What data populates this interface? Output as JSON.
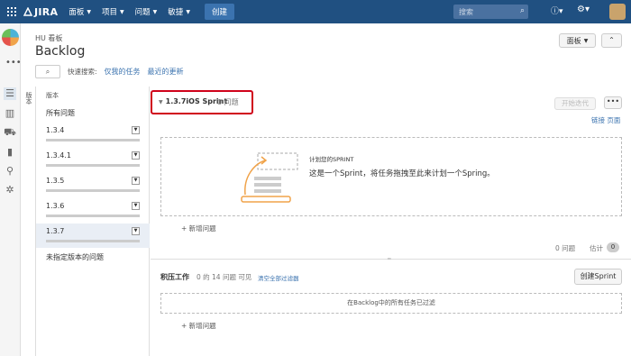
{
  "nav": {
    "logo": "JIRA",
    "menus": [
      "面板",
      "项目",
      "问题",
      "敏捷"
    ],
    "create": "创建",
    "search_placeholder": "搜索"
  },
  "header": {
    "project": "HU 看板",
    "title": "Backlog",
    "board_button": "面板",
    "quick_filters_label": "快速搜索:",
    "quick_filters": [
      "仅我的任务",
      "最近的更新"
    ]
  },
  "versions": {
    "toggle_label": "版本",
    "heading": "版本",
    "all_issues": "所有问题",
    "items": [
      "1.3.4",
      "1.3.4.1",
      "1.3.5",
      "1.3.6",
      "1.3.7"
    ],
    "active_index": 4,
    "unassigned": "未指定版本的问题"
  },
  "sprint": {
    "name": "1.3.7iOS Sprint",
    "count": "0 问题",
    "start_button": "开始迭代",
    "more_button": "•••",
    "links": "链接 页面",
    "plan_small": "计划您的SPRINT",
    "plan_big": "这是一个Sprint，将任务拖拽至此来计划一个Spring。",
    "add_issue": "+ 新增问题",
    "issue_count": "0 问题",
    "estimate_label": "估计",
    "estimate_value": "0"
  },
  "backlog": {
    "title": "积压工作",
    "count": "0 的 14 问题 可见",
    "clear_filters": "清空全部过滤器",
    "create_sprint": "创建Sprint",
    "filtered_msg": "在Backlog中的所有任务已过滤",
    "add_issue": "+ 新增问题"
  },
  "colors": {
    "nav_bg": "#205081",
    "highlight_border": "#d0021b",
    "link": "#3b73af"
  }
}
